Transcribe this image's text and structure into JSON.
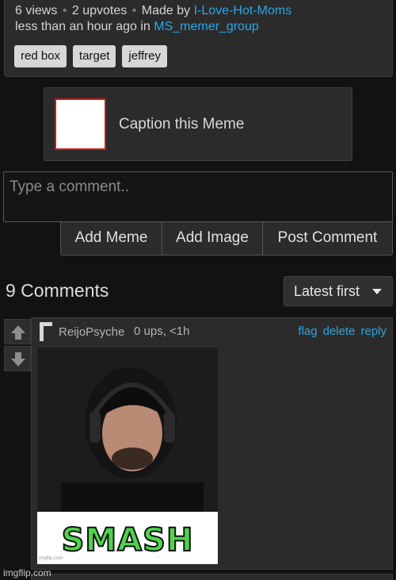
{
  "meme_info": {
    "views": "6 views",
    "upvotes": "2 upvotes",
    "made_by_prefix": "Made by",
    "author": "I-Love-Hot-Moms",
    "time_prefix": "less than an hour ago in",
    "stream": "MS_memer_group",
    "tags": [
      "red box",
      "target",
      "jeffrey"
    ]
  },
  "caption": {
    "label": "Caption this Meme"
  },
  "comment_form": {
    "placeholder": "Type a comment..",
    "buttons": {
      "add_meme": "Add Meme",
      "add_image": "Add Image",
      "post_comment": "Post Comment"
    }
  },
  "comments_header": {
    "count_label": "9 Comments",
    "sort_label": "Latest first"
  },
  "comments": [
    {
      "user": "ReijoPsyche",
      "meta": "0 ups, <1h",
      "actions": [
        "flag",
        "delete",
        "reply"
      ],
      "image_text": "SMASH",
      "image_credit": "imgflip.com"
    }
  ],
  "footer": {
    "watermark": "imgflip.com"
  },
  "colors": {
    "link": "#2aa6e6",
    "panel": "#2b2b2b",
    "background": "#121212",
    "tag_bg": "#d7d7d7",
    "smash_green": "#4ed44c"
  },
  "icons": [
    "upvote-arrow-icon",
    "downvote-arrow-icon",
    "caret-down-icon",
    "user-avatar-icon"
  ]
}
